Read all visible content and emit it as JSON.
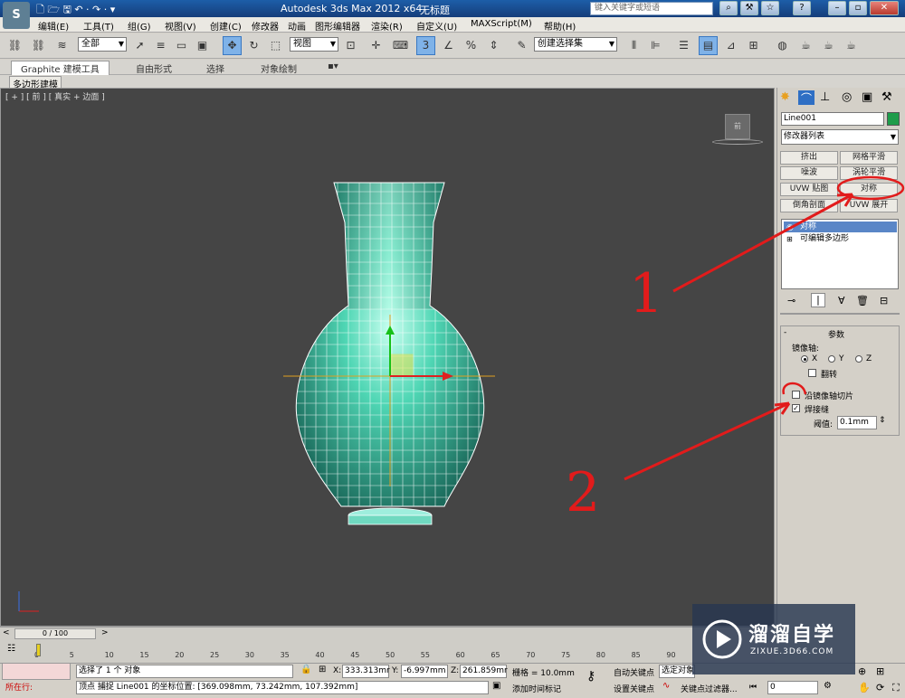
{
  "title": {
    "app": "Autodesk 3ds Max  2012 x64",
    "doc": "无标题",
    "search_placeholder": "键入关键字或短语"
  },
  "menu": [
    "编辑(E)",
    "工具(T)",
    "组(G)",
    "视图(V)",
    "创建(C)",
    "修改器",
    "动画",
    "图形编辑器",
    "渲染(R)",
    "自定义(U)",
    "MAXScript(M)",
    "帮助(H)"
  ],
  "toolbar": {
    "selection_filter": "全部",
    "ref_coord": "视图",
    "named_selection": "创建选择集"
  },
  "ribbon": {
    "tabs": [
      "Graphite 建模工具",
      "自由形式",
      "选择",
      "对象绘制"
    ],
    "active": "Graphite 建模工具",
    "subpanel": "多边形建模"
  },
  "viewport": {
    "label": "[ + ] [ 前 ] [ 真实 + 边面 ]",
    "viewcube": "前"
  },
  "panel": {
    "object_name": "Line001",
    "object_color": "#1e9c4a",
    "modifier_list": "修改器列表",
    "buttons": [
      "挤出",
      "网格平滑",
      "噪波",
      "涡轮平滑",
      "UVW 贴图",
      "对称",
      "倒角剖面",
      "UVW 展开"
    ],
    "stack": [
      {
        "label": "对称",
        "selected": true
      },
      {
        "label": "可编辑多边形",
        "selected": false
      }
    ],
    "rollout_title": "参数",
    "mirror_axis_label": "镜像轴:",
    "axes": [
      {
        "label": "X",
        "selected": true
      },
      {
        "label": "Y",
        "selected": false
      },
      {
        "label": "Z",
        "selected": false
      }
    ],
    "flip": {
      "label": "翻转",
      "checked": false
    },
    "slice": {
      "label": "沿镜像轴切片",
      "checked": false
    },
    "weld": {
      "label": "焊接缝",
      "checked": true
    },
    "threshold_label": "阈值:",
    "threshold_value": "0.1mm"
  },
  "timeline": {
    "frame": "0 / 100",
    "ticks": [
      "0",
      "5",
      "10",
      "15",
      "20",
      "25",
      "30",
      "35",
      "40",
      "45",
      "50",
      "55",
      "60",
      "65",
      "70",
      "75",
      "80",
      "85",
      "90"
    ]
  },
  "status": {
    "maxscript_prompt": "所在行:",
    "selection": "选择了 1 个 对象",
    "prompt": "顶点 捕捉 Line001 的坐标位置: [369.098mm, 73.242mm, 107.392mm]",
    "x_label": "X:",
    "x": "333.313mr",
    "y_label": "Y:",
    "y": "-6.997mm",
    "z_label": "Z:",
    "z": "261.859mr",
    "grid": "栅格 = 10.0mm",
    "add_time_tag": "添加时间标记",
    "auto_key": "自动关键点",
    "selected_obj": "选定对象",
    "set_key": "设置关键点",
    "key_filters": "关键点过滤器...",
    "frame": "0"
  },
  "annotations": [
    "1",
    "2"
  ],
  "watermark": {
    "brand": "溜溜自学",
    "url": "ZIXUE.3D66.COM"
  }
}
